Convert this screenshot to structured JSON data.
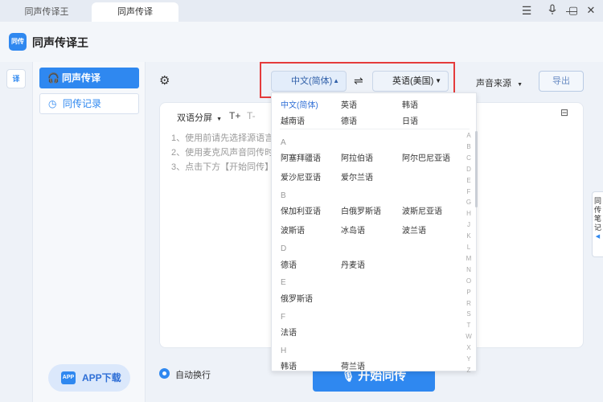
{
  "tabs": [
    "同声传译王",
    "同声传译"
  ],
  "window_controls": [
    "☰",
    "🎙",
    "—",
    "▢",
    "✕"
  ],
  "app": {
    "title": "同声传译王",
    "logo_text": "同传"
  },
  "sidebar": {
    "rail_icon": "译",
    "items": [
      {
        "label": "同声传译",
        "icon": "headset-icon",
        "active": true
      },
      {
        "label": "同传记录",
        "icon": "clock-icon",
        "active": false
      }
    ],
    "app_download": "APP下载",
    "app_icon_text": "APP"
  },
  "toolbar": {
    "source_lang": "中文(简体)",
    "target_lang": "英语(美国)",
    "swap_symbol": "⇌",
    "sound_source": "声音来源",
    "export": "导出"
  },
  "editor": {
    "mode": "双语分屏",
    "font_increase": "T+",
    "font_decrease": "T-",
    "hints": [
      "1、使用前请先选择源语言",
      "2、使用麦克风声音同传时",
      "3、点击下方【开始同传】"
    ]
  },
  "side_note_tab": "同传笔记",
  "bottom": {
    "auto_wrap": "自动换行",
    "start": "开始同传"
  },
  "dropdown": {
    "common": [
      "中文(简体)",
      "英语",
      "韩语",
      "越南语",
      "德语",
      "日语"
    ],
    "selected": "中文(简体)",
    "groups": [
      {
        "letter": "A",
        "items": [
          "阿塞拜疆语",
          "阿拉伯语",
          "阿尔巴尼亚语",
          "爱沙尼亚语",
          "爱尔兰语"
        ]
      },
      {
        "letter": "B",
        "items": [
          "保加利亚语",
          "白俄罗斯语",
          "波斯尼亚语",
          "波斯语",
          "冰岛语",
          "波兰语"
        ]
      },
      {
        "letter": "D",
        "items": [
          "德语",
          "丹麦语"
        ]
      },
      {
        "letter": "E",
        "items": [
          "俄罗斯语"
        ]
      },
      {
        "letter": "F",
        "items": [
          "法语"
        ]
      },
      {
        "letter": "H",
        "items": [
          "韩语",
          "荷兰语"
        ]
      }
    ],
    "index": [
      "A",
      "B",
      "C",
      "D",
      "E",
      "F",
      "G",
      "H",
      "J",
      "K",
      "L",
      "M",
      "N",
      "O",
      "P",
      "R",
      "S",
      "T",
      "W",
      "X",
      "Y",
      "Z"
    ]
  },
  "colors": {
    "accent": "#2f88f0",
    "highlight_box": "#e53b3b"
  }
}
